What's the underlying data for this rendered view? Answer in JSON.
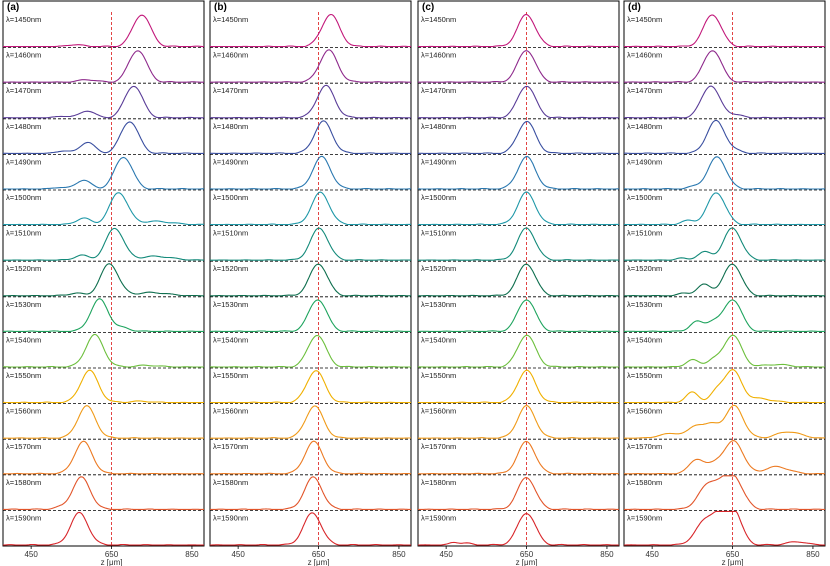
{
  "chart_data": {
    "type": "line",
    "xlabel": "z [μm]",
    "xlim": [
      380,
      880
    ],
    "xticks": [
      450,
      650,
      850
    ],
    "reference_line_z": 650,
    "wavelength_labels": [
      "λ=1450nm",
      "λ=1460nm",
      "λ=1470nm",
      "λ=1480nm",
      "λ=1490nm",
      "λ=1500nm",
      "λ=1510nm",
      "λ=1520nm",
      "λ=1530nm",
      "λ=1540nm",
      "λ=1550nm",
      "λ=1560nm",
      "λ=1570nm",
      "λ=1580nm",
      "λ=1590nm"
    ],
    "colors": [
      "#c2187a",
      "#8e2a8c",
      "#5a3d98",
      "#3a4fa0",
      "#2a78b0",
      "#1f98a8",
      "#138a7a",
      "#0e6e4e",
      "#1ea45e",
      "#6cbf3c",
      "#f0b000",
      "#f09a18",
      "#ec7a22",
      "#e2552a",
      "#d8262a"
    ],
    "panels": [
      {
        "label": "(a)",
        "peaks_z": [
          725,
          715,
          705,
          695,
          680,
          668,
          658,
          645,
          620,
          608,
          595,
          588,
          580,
          575,
          570
        ],
        "side_peaks": [
          [
            [
              560,
              0.06,
              20
            ]
          ],
          [
            [
              590,
              0.08,
              22
            ]
          ],
          [
            [
              590,
              0.22,
              18
            ],
            [
              530,
              0.05,
              18
            ]
          ],
          [
            [
              590,
              0.35,
              18
            ],
            [
              530,
              0.08,
              16
            ]
          ],
          [
            [
              580,
              0.28,
              18
            ],
            [
              520,
              0.05,
              16
            ]
          ],
          [
            [
              580,
              0.2,
              18
            ],
            [
              760,
              0.1,
              40
            ]
          ],
          [
            [
              575,
              0.15,
              18
            ],
            [
              760,
              0.12,
              40
            ]
          ],
          [
            [
              560,
              0.08,
              18
            ],
            [
              750,
              0.1,
              40
            ]
          ],
          [
            [
              680,
              0.1,
              18
            ]
          ],
          [
            [
              740,
              0.05,
              30
            ]
          ],
          [
            [
              720,
              0.04,
              30
            ]
          ],
          [],
          [],
          [
            [
              520,
              0.05,
              20
            ]
          ],
          []
        ]
      },
      {
        "label": "(b)",
        "peaks_z": [
          680,
          675,
          668,
          662,
          658,
          655,
          652,
          650,
          648,
          646,
          643,
          640,
          638,
          637,
          635
        ],
        "side_peaks": [
          [],
          [],
          [],
          [],
          [],
          [],
          [],
          [],
          [],
          [],
          [],
          [],
          [],
          [],
          []
        ]
      },
      {
        "label": "(c)",
        "peaks_z": [
          650,
          650,
          650,
          650,
          650,
          650,
          650,
          650,
          650,
          650,
          650,
          650,
          650,
          650,
          650
        ],
        "side_peaks": [
          [],
          [],
          [],
          [],
          [],
          [],
          [],
          [],
          [],
          [],
          [],
          [],
          [],
          [],
          [
            [
              470,
              0.08,
              12
            ],
            [
              500,
              0.06,
              12
            ]
          ]
        ]
      },
      {
        "label": "(d)",
        "peaks_z": [
          600,
          600,
          595,
          608,
          612,
          610,
          650,
          650,
          650,
          650,
          650,
          655,
          655,
          650,
          650
        ],
        "side_peaks": [
          [],
          [],
          [
            [
              650,
              0.1,
              22
            ]
          ],
          [
            [
              650,
              0.08,
              22
            ]
          ],
          [
            [
              560,
              0.08,
              18
            ]
          ],
          [
            [
              540,
              0.12,
              18
            ]
          ],
          [
            [
              580,
              0.25,
              18
            ],
            [
              520,
              0.06,
              14
            ]
          ],
          [
            [
              580,
              0.35,
              18
            ],
            [
              530,
              0.08,
              14
            ]
          ],
          [
            [
              560,
              0.3,
              16
            ],
            [
              600,
              0.28,
              16
            ]
          ],
          [
            [
              550,
              0.22,
              16
            ],
            [
              600,
              0.2,
              16
            ],
            [
              760,
              0.08,
              30
            ]
          ],
          [
            [
              550,
              0.32,
              16
            ],
            [
              610,
              0.28,
              16
            ],
            [
              720,
              0.12,
              30
            ]
          ],
          [
            [
              560,
              0.35,
              18
            ],
            [
              600,
              0.4,
              20
            ],
            [
              790,
              0.2,
              30
            ],
            [
              500,
              0.15,
              30
            ]
          ],
          [
            [
              560,
              0.45,
              18
            ],
            [
              610,
              0.35,
              20
            ],
            [
              760,
              0.22,
              30
            ]
          ],
          [
            [
              580,
              0.5,
              22
            ],
            [
              610,
              0.55,
              22
            ],
            [
              680,
              0.1,
              20
            ]
          ],
          [
            [
              580,
              0.65,
              24
            ],
            [
              620,
              0.65,
              24
            ],
            [
              810,
              0.1,
              25
            ]
          ]
        ]
      }
    ]
  }
}
